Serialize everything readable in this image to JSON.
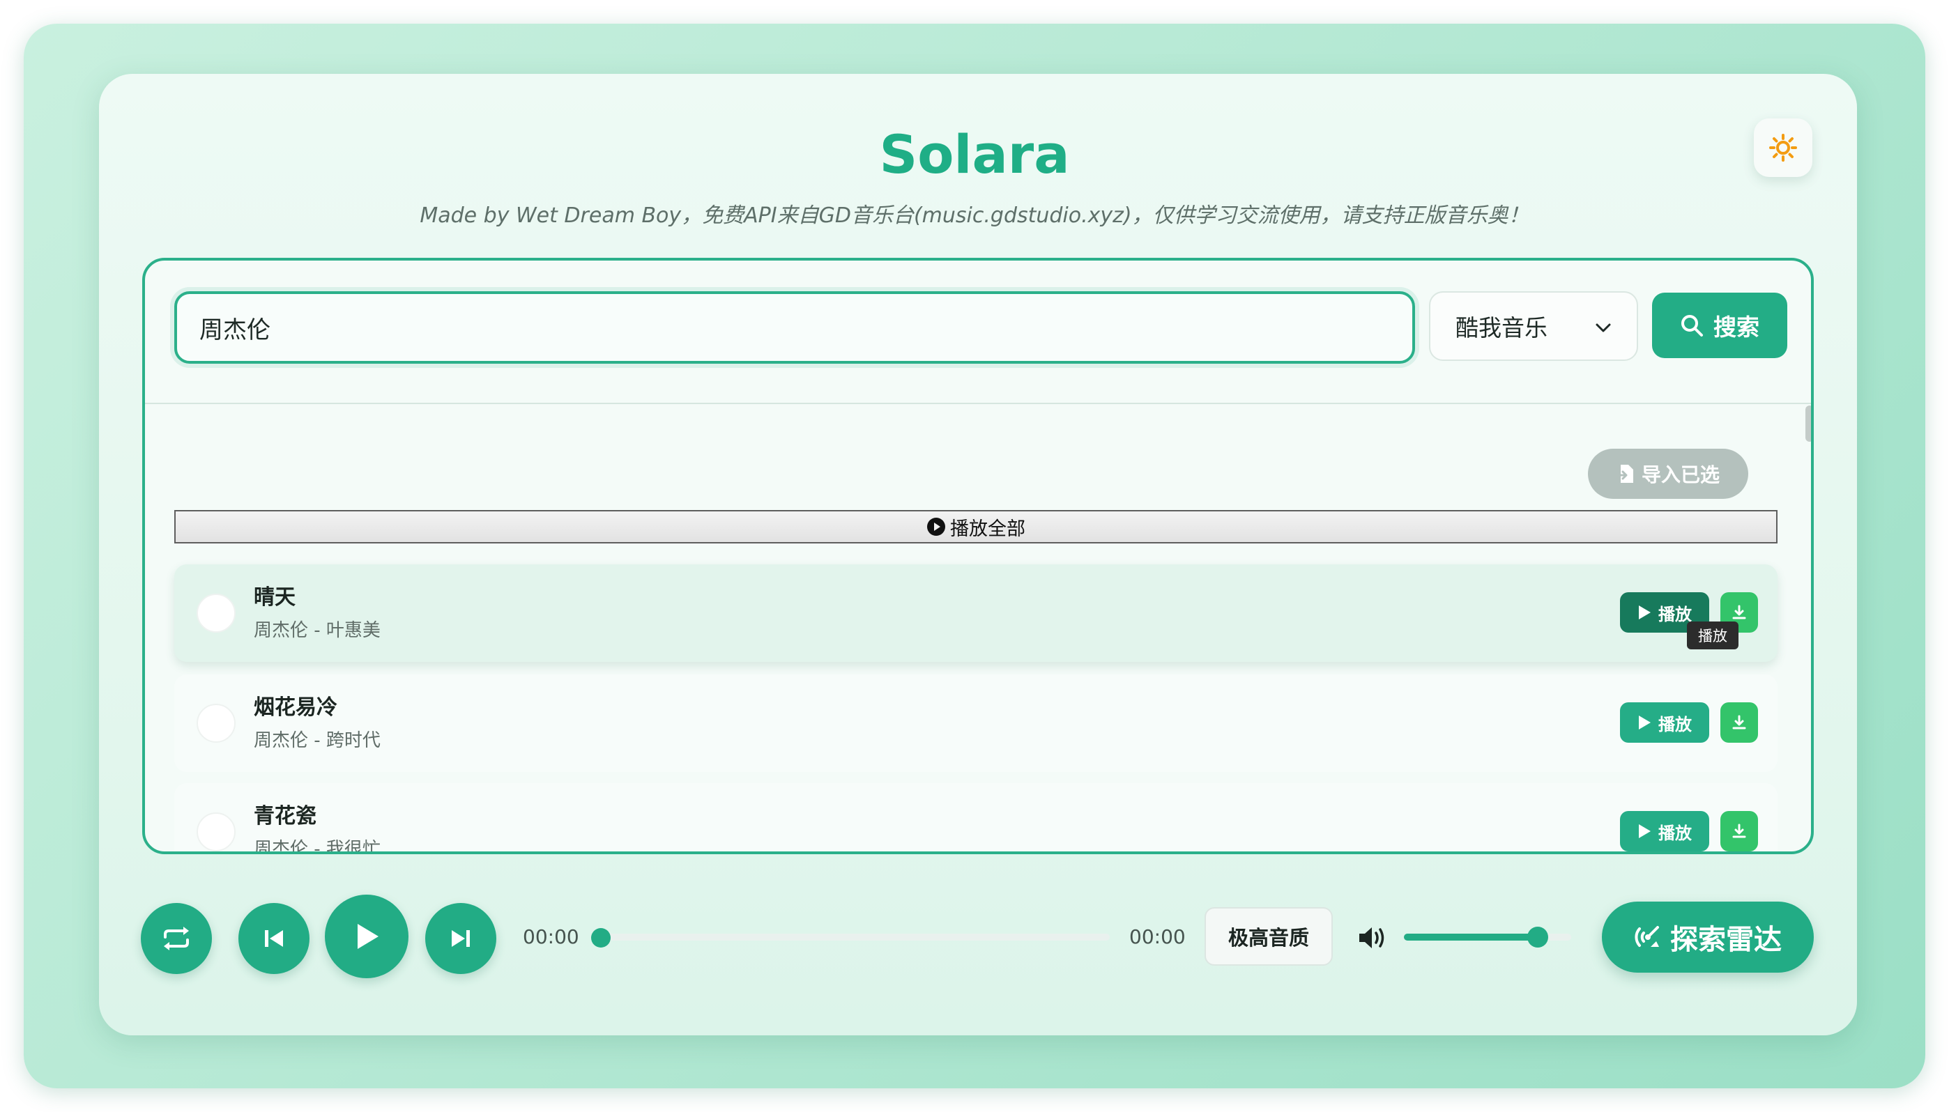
{
  "app": {
    "title": "Solara",
    "subtitle": "Made by Wet Dream Boy，免费API来自GD音乐台(music.gdstudio.xyz)，仅供学习交流使用，请支持正版音乐奥！"
  },
  "search": {
    "query": "周杰伦",
    "source": "酷我音乐",
    "button_label": "搜索"
  },
  "results": {
    "import_label": "导入已选",
    "play_all_label": "播放全部",
    "play_label": "播放",
    "tooltip": "播放",
    "songs": [
      {
        "title": "晴天",
        "meta": "周杰伦 - 叶惠美",
        "active": true
      },
      {
        "title": "烟花易冷",
        "meta": "周杰伦 - 跨时代",
        "active": false
      },
      {
        "title": "青花瓷",
        "meta": "周杰伦 - 我很忙",
        "active": false
      }
    ]
  },
  "player": {
    "current_time": "00:00",
    "duration": "00:00",
    "progress": 0,
    "quality_label": "极高音质",
    "volume": 0.8,
    "explore_label": "探索雷达"
  },
  "colors": {
    "accent": "#22ac85",
    "accent_dark": "#177a5c",
    "download": "#33c46a",
    "theme_icon": "#f39c12"
  },
  "icons": {
    "theme": "sun-icon",
    "search": "search-icon",
    "dropdown": "chevron-down-icon",
    "import": "file-import-icon",
    "play_all": "play-circle-icon",
    "download": "download-icon",
    "repeat": "repeat-icon",
    "previous": "skip-previous-icon",
    "play": "play-icon",
    "next": "skip-next-icon",
    "volume": "volume-icon",
    "radar": "radar-icon"
  }
}
